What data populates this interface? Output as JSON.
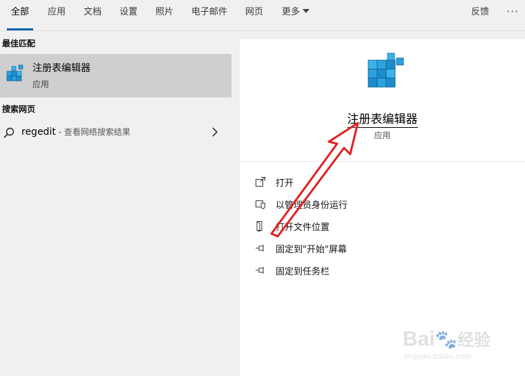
{
  "tabs": [
    {
      "label": "全部",
      "active": true
    },
    {
      "label": "应用"
    },
    {
      "label": "文档"
    },
    {
      "label": "设置"
    },
    {
      "label": "照片"
    },
    {
      "label": "电子邮件"
    },
    {
      "label": "网页"
    },
    {
      "label": "更多"
    }
  ],
  "header": {
    "feedback_label": "反馈",
    "more_label": "···"
  },
  "left": {
    "best_match_heading": "最佳匹配",
    "best_match": {
      "name": "注册表编辑器",
      "type": "应用",
      "icon": "registry-cubes-icon"
    },
    "web_heading": "搜索网页",
    "web_result": {
      "query": "regedit",
      "hint": " - 查看网络搜索结果"
    }
  },
  "right": {
    "title": "注册表编辑器",
    "subtitle": "应用",
    "actions": [
      {
        "label": "打开",
        "icon": "open-icon"
      },
      {
        "label": "以管理员身份运行",
        "icon": "shield-icon"
      },
      {
        "label": "打开文件位置",
        "icon": "folder-icon"
      },
      {
        "label": "固定到\"开始\"屏幕",
        "icon": "pin-icon"
      },
      {
        "label": "固定到任务栏",
        "icon": "pin-icon"
      }
    ]
  },
  "watermark": {
    "main": "Bai",
    "main2": "经验",
    "sub": "jingyan.baidu.com"
  },
  "colors": {
    "accent": "#0063b1",
    "selected_row": "#cfcfcf",
    "annotation": "#e02020"
  }
}
